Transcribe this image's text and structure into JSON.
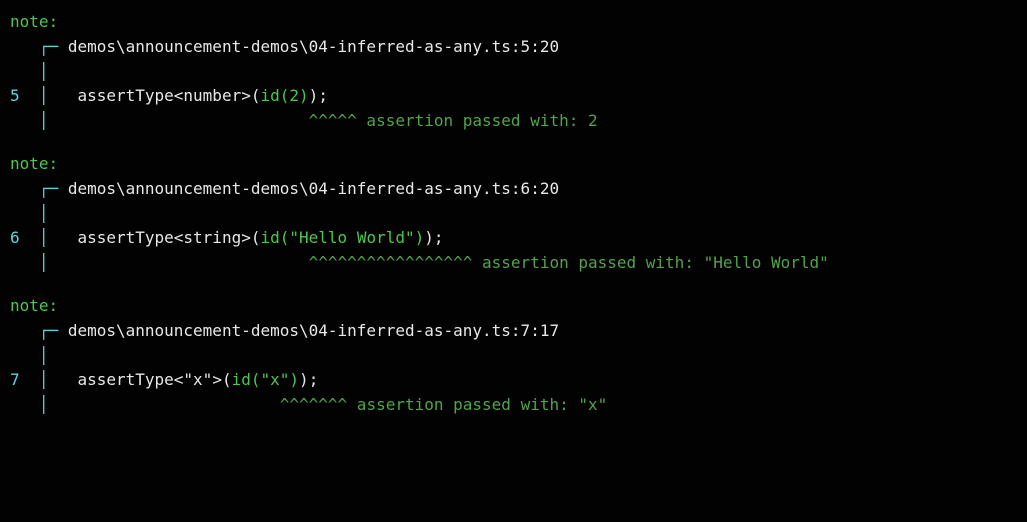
{
  "notes": [
    {
      "label": "note:",
      "file": "demos\\announcement-demos\\04-inferred-as-any.ts:5:20",
      "lineno": "5",
      "assert": "assertType",
      "gen_open": "<",
      "gen_type": "number",
      "gen_close": ">",
      "paren_open": "(",
      "call": "id",
      "arg_open": "(",
      "arg": "2",
      "arg_close": ")",
      "paren_close": ")",
      "semi": ";",
      "caret_pad": "                        ",
      "carets": "^^^^^",
      "msg": " assertion passed with: 2"
    },
    {
      "label": "note:",
      "file": "demos\\announcement-demos\\04-inferred-as-any.ts:6:20",
      "lineno": "6",
      "assert": "assertType",
      "gen_open": "<",
      "gen_type": "string",
      "gen_close": ">",
      "paren_open": "(",
      "call": "id",
      "arg_open": "(",
      "arg": "\"Hello World\"",
      "arg_close": ")",
      "paren_close": ")",
      "semi": ";",
      "caret_pad": "                        ",
      "carets": "^^^^^^^^^^^^^^^^^",
      "msg": " assertion passed with: \"Hello World\""
    },
    {
      "label": "note:",
      "file": "demos\\announcement-demos\\04-inferred-as-any.ts:7:17",
      "lineno": "7",
      "assert": "assertType",
      "gen_open": "<",
      "gen_type": "\"x\"",
      "gen_close": ">",
      "paren_open": "(",
      "call": "id",
      "arg_open": "(",
      "arg": "\"x\"",
      "arg_close": ")",
      "paren_close": ")",
      "semi": ";",
      "caret_pad": "                     ",
      "carets": "^^^^^^^",
      "msg": " assertion passed with: \"x\""
    }
  ]
}
